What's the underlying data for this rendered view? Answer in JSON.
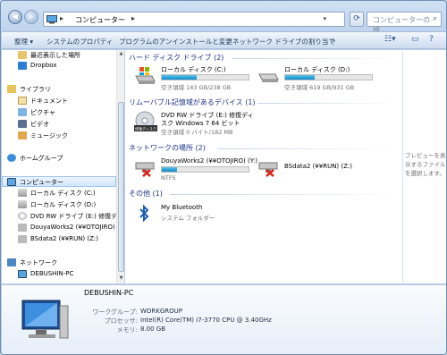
{
  "address": {
    "crumb": "コンピューター",
    "sep1": "▸",
    "sep2": "▸",
    "dropdown": "▾"
  },
  "search": {
    "placeholder": "コンピューターの検..."
  },
  "toolbar": {
    "organize": "整理 ▾",
    "system_properties": "システムのプロパティ",
    "uninstall": "プログラムのアンインストールと変更",
    "map_drive": "ネットワーク ドライブの割り当て",
    "more": "»"
  },
  "nav": {
    "items": [
      {
        "label": "最近表示した場所",
        "icon": "recent-places-icon"
      },
      {
        "label": "Dropbox",
        "icon": "dropbox-icon"
      },
      {
        "label": "ライブラリ",
        "icon": "libraries-icon"
      },
      {
        "label": "ドキュメント",
        "icon": "documents-icon"
      },
      {
        "label": "ピクチャ",
        "icon": "pictures-icon"
      },
      {
        "label": "ビデオ",
        "icon": "videos-icon"
      },
      {
        "label": "ミュージック",
        "icon": "music-icon"
      },
      {
        "label": "ホームグループ",
        "icon": "homegroup-icon"
      },
      {
        "label": "コンピューター",
        "icon": "computer-icon"
      },
      {
        "label": "ローカル ディスク (C:)",
        "icon": "local-disk-icon"
      },
      {
        "label": "ローカル ディスク (D:)",
        "icon": "local-disk-icon"
      },
      {
        "label": "DVD RW ドライブ (E:) 修復ディ",
        "icon": "dvd-drive-icon"
      },
      {
        "label": "DouyaWorks2 (¥¥OTOJIRO) (Y:",
        "icon": "network-drive-icon"
      },
      {
        "label": "BSdata2 (¥¥RUN) (Z:)",
        "icon": "network-drive-icon"
      },
      {
        "label": "ネットワーク",
        "icon": "network-icon"
      },
      {
        "label": "DEBUSHIN-PC",
        "icon": "pc-icon"
      }
    ]
  },
  "content": {
    "groups": {
      "hdd": "ハード ディスク ドライブ (2)",
      "removable": "リムーバブル記憶域があるデバイス (1)",
      "network": "ネットワークの場所 (2)",
      "other": "その他 (1)"
    },
    "drives": {
      "c": {
        "name": "ローカル ディスク (C:)",
        "sub": "空き領域 143 GB/238 GB",
        "used_fraction": 0.4
      },
      "d": {
        "name": "ローカル ディスク (D:)",
        "sub": "空き領域 619 GB/931 GB",
        "used_fraction": 0.34
      },
      "e": {
        "name1": "DVD RW ドライブ (E:) 修復ディ",
        "name2": "スク Windows 7 64 ビット",
        "sub": "空き領域 0 バイト/182 MB",
        "disc_label": "修復ディスク"
      },
      "y": {
        "name": "DouyaWorks2 (¥¥OTOJIRO) (Y:)",
        "sub": "NTFS",
        "used_fraction": 0.18
      },
      "z": {
        "name": "BSdata2 (¥¥RUN) (Z:)"
      },
      "bt": {
        "name": "My Bluetooth",
        "sub": "システム フォルダー"
      }
    }
  },
  "preview": {
    "text": "プレビューを表示するファイルを選択します。"
  },
  "details": {
    "title": "DEBUSHIN-PC",
    "workgroup_key": "ワークグループ:",
    "workgroup_val": "WORKGROUP",
    "cpu_key": "プロセッサ:",
    "cpu_val": "Intel(R) Core(TM) i7-3770 CPU @ 3.40GHz",
    "mem_key": "メモリ:",
    "mem_val": "8.00 GB"
  },
  "colors": {
    "accent": "#26a0da",
    "group_header": "#1e3287",
    "window_frame": "#bcd2ec"
  }
}
